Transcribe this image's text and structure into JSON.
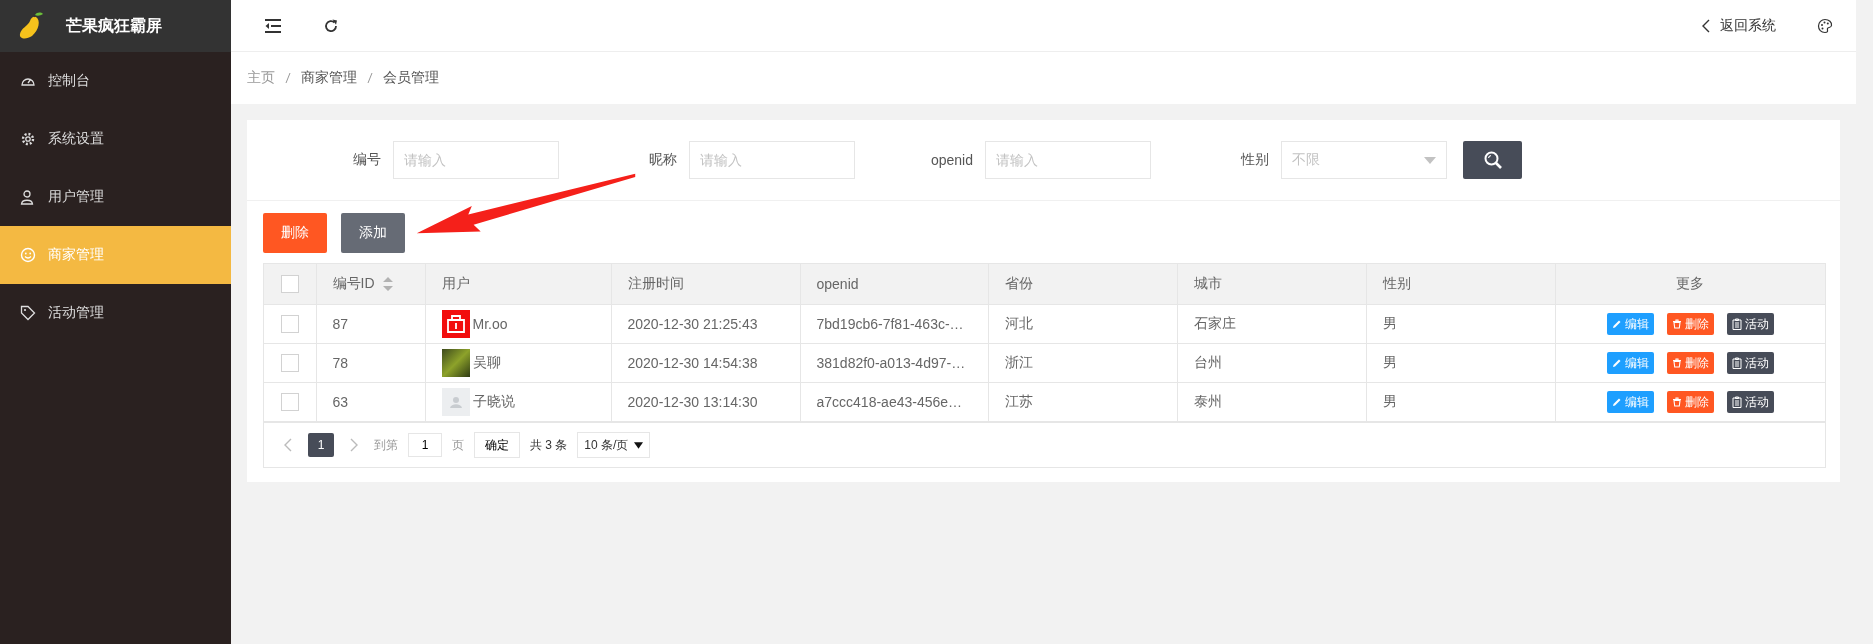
{
  "brand": {
    "title": "芒果疯狂霸屏"
  },
  "sidebar": {
    "items": [
      {
        "label": "控制台",
        "kind": "gauge",
        "selected": false
      },
      {
        "label": "系统设置",
        "kind": "gear",
        "selected": false
      },
      {
        "label": "用户管理",
        "kind": "user",
        "selected": false
      },
      {
        "label": "商家管理",
        "kind": "smile",
        "selected": true
      },
      {
        "label": "活动管理",
        "kind": "tag",
        "selected": false
      }
    ]
  },
  "header": {
    "back_link": "返回系统"
  },
  "breadcrumb": [
    "主页",
    "商家管理",
    "会员管理"
  ],
  "filters": [
    {
      "label": "编号",
      "kind": "input",
      "placeholder": "请输入"
    },
    {
      "label": "昵称",
      "kind": "input",
      "placeholder": "请输入"
    },
    {
      "label": "openid",
      "kind": "input",
      "placeholder": "请输入"
    },
    {
      "label": "性别",
      "kind": "select",
      "placeholder": "不限"
    }
  ],
  "toolbar": [
    {
      "label": "删除",
      "kind": "danger"
    },
    {
      "label": "添加",
      "kind": "plain"
    }
  ],
  "table": {
    "header_checked": false,
    "columns": [
      {
        "label": "编号ID",
        "sortable": true
      },
      {
        "label": "用户",
        "sortable": false
      },
      {
        "label": "注册时间",
        "sortable": false
      },
      {
        "label": "openid",
        "sortable": false
      },
      {
        "label": "省份",
        "sortable": false
      },
      {
        "label": "城市",
        "sortable": false
      },
      {
        "label": "性别",
        "sortable": false
      },
      {
        "label": "更多",
        "sortable": false
      }
    ],
    "rows": [
      {
        "checked": false,
        "id": "87",
        "kind": "logo",
        "user": "Mr.oo",
        "time": "2020-12-30 21:25:43",
        "openid": "7bd19cb6-7f81-463c-…",
        "province": "河北",
        "city": "石家庄",
        "gender": "男",
        "actions": [
          {
            "label": "编辑",
            "kind": "edit"
          },
          {
            "label": "删除",
            "kind": "delete"
          },
          {
            "label": "活动",
            "kind": "activity"
          }
        ]
      },
      {
        "checked": false,
        "id": "78",
        "kind": "photo",
        "user": "吴聊",
        "time": "2020-12-30 14:54:38",
        "openid": "381d82f0-a013-4d97-…",
        "province": "浙江",
        "city": "台州",
        "gender": "男",
        "actions": [
          {
            "label": "编辑",
            "kind": "edit"
          },
          {
            "label": "删除",
            "kind": "delete"
          },
          {
            "label": "活动",
            "kind": "activity"
          }
        ]
      },
      {
        "checked": false,
        "id": "63",
        "kind": "default",
        "user": "子晓说",
        "time": "2020-12-30 13:14:30",
        "openid": "a7ccc418-ae43-456e…",
        "province": "江苏",
        "city": "泰州",
        "gender": "男",
        "actions": [
          {
            "label": "编辑",
            "kind": "edit"
          },
          {
            "label": "删除",
            "kind": "delete"
          },
          {
            "label": "活动",
            "kind": "activity"
          }
        ]
      }
    ]
  },
  "pagination": {
    "pages": [
      {
        "label": "1",
        "selected": true
      }
    ],
    "goto_label": "到第",
    "goto_value": "1",
    "page_unit": "页",
    "confirm": "确定",
    "total": "共 3 条",
    "page_size": "10 条/页"
  }
}
